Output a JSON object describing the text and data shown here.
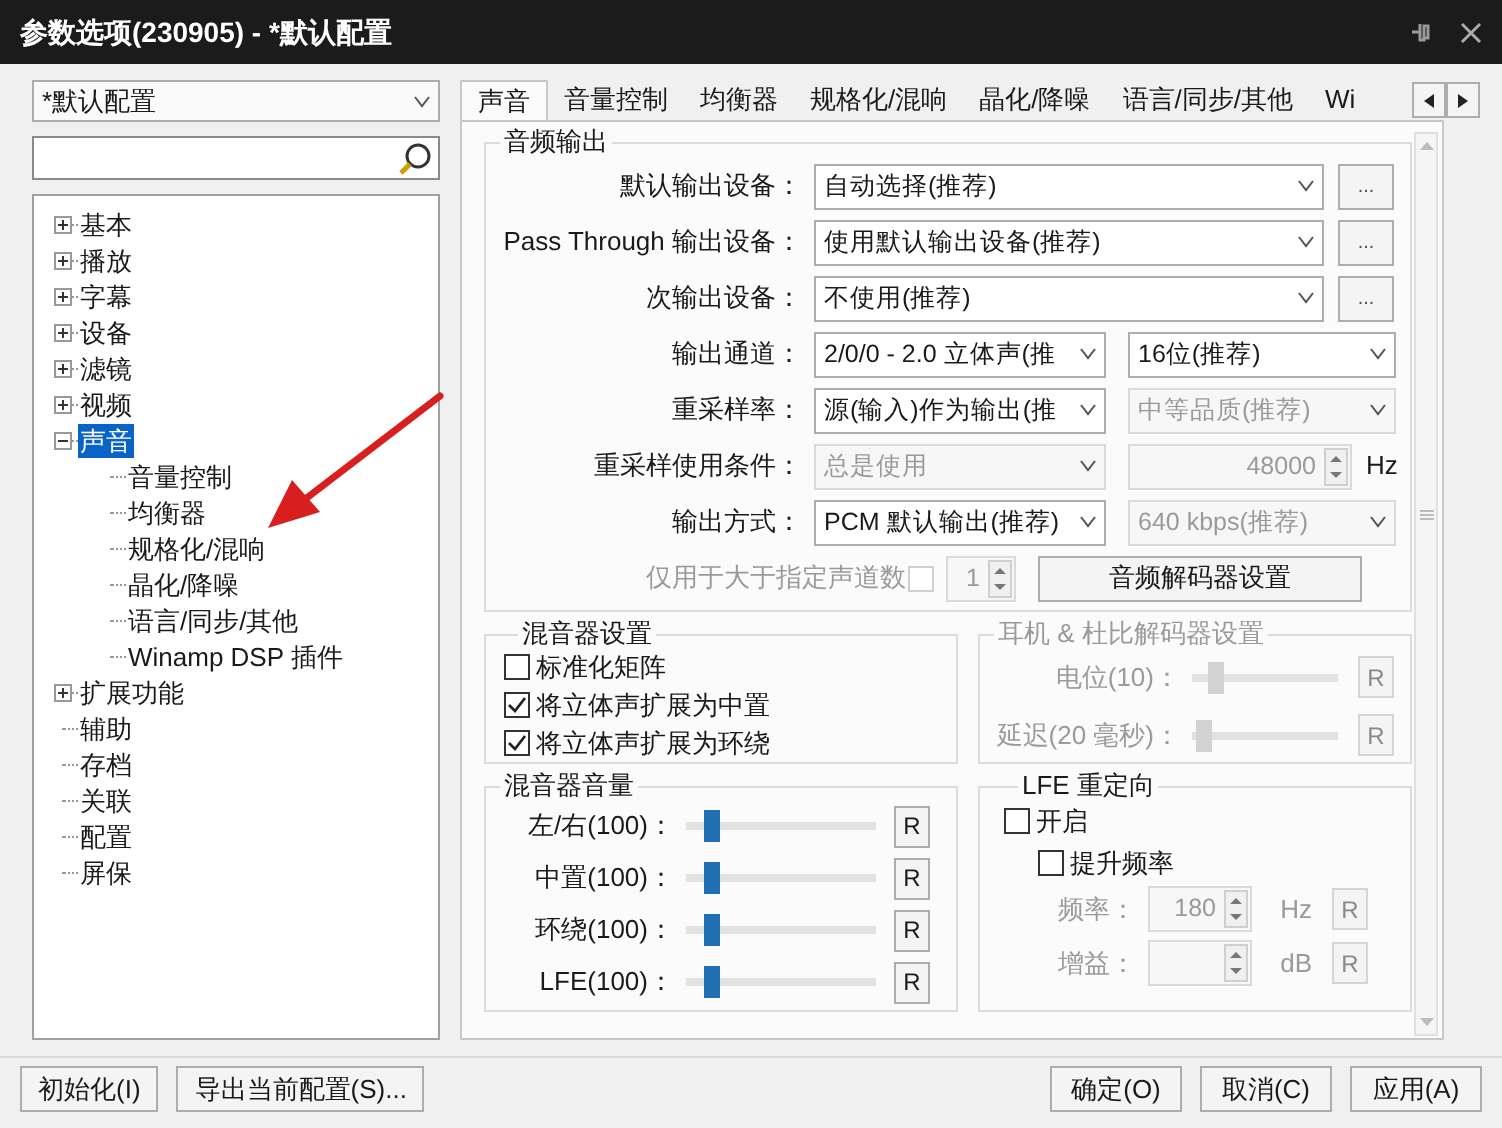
{
  "window": {
    "title": "参数选项(230905) - *默认配置"
  },
  "profile_select": {
    "value": "*默认配置"
  },
  "tree": [
    {
      "label": "基本",
      "kind": "folder",
      "expanded": false,
      "selected": false
    },
    {
      "label": "播放",
      "kind": "folder",
      "expanded": false,
      "selected": false
    },
    {
      "label": "字幕",
      "kind": "folder",
      "expanded": false,
      "selected": false
    },
    {
      "label": "设备",
      "kind": "folder",
      "expanded": false,
      "selected": false
    },
    {
      "label": "滤镜",
      "kind": "folder",
      "expanded": false,
      "selected": false
    },
    {
      "label": "视频",
      "kind": "folder",
      "expanded": false,
      "selected": false
    },
    {
      "label": "声音",
      "kind": "folder",
      "expanded": true,
      "selected": true,
      "children": [
        {
          "label": "音量控制",
          "kind": "leaf",
          "selected": false
        },
        {
          "label": "均衡器",
          "kind": "leaf",
          "selected": false
        },
        {
          "label": "规格化/混响",
          "kind": "leaf",
          "selected": false
        },
        {
          "label": "晶化/降噪",
          "kind": "leaf",
          "selected": false
        },
        {
          "label": "语言/同步/其他",
          "kind": "leaf",
          "selected": false
        },
        {
          "label": "Winamp DSP 插件",
          "kind": "leaf",
          "selected": false
        }
      ]
    },
    {
      "label": "扩展功能",
      "kind": "folder",
      "expanded": false,
      "selected": false
    },
    {
      "label": "辅助",
      "kind": "leaf",
      "selected": false
    },
    {
      "label": "存档",
      "kind": "leaf",
      "selected": false
    },
    {
      "label": "关联",
      "kind": "leaf",
      "selected": false
    },
    {
      "label": "配置",
      "kind": "leaf",
      "selected": false
    },
    {
      "label": "屏保",
      "kind": "leaf",
      "selected": false
    }
  ],
  "tabs": [
    {
      "label": "声音",
      "selected": true
    },
    {
      "label": "音量控制",
      "selected": false
    },
    {
      "label": "均衡器",
      "selected": false
    },
    {
      "label": "规格化/混响",
      "selected": false
    },
    {
      "label": "晶化/降噪",
      "selected": false
    },
    {
      "label": "语言/同步/其他",
      "selected": false
    },
    {
      "label": "Wi",
      "selected": false
    }
  ],
  "audio_output": {
    "title": "音频输出",
    "rows": [
      {
        "kind": "device",
        "label": "默认输出设备：",
        "value": "自动选择(推荐)",
        "button": "..."
      },
      {
        "kind": "device",
        "label": "Pass Through 输出设备：",
        "value": "使用默认输出设备(推荐)",
        "button": "..."
      },
      {
        "kind": "device",
        "label": "次输出设备：",
        "value": "不使用(推荐)",
        "button": "..."
      },
      {
        "kind": "pair",
        "label": "输出通道：",
        "left": {
          "value": "2/0/0 - 2.0 立体声(推",
          "disabled": false
        },
        "right": {
          "value": "16位(推荐)",
          "disabled": false
        }
      },
      {
        "kind": "pair",
        "label": "重采样率：",
        "left": {
          "value": "源(输入)作为输出(推",
          "disabled": false
        },
        "right": {
          "value": "中等品质(推荐)",
          "disabled": true
        }
      },
      {
        "kind": "combo_spin",
        "label": "重采样使用条件：",
        "left": {
          "value": "总是使用",
          "disabled": true
        },
        "spin": {
          "value": "48000",
          "unit": "Hz",
          "disabled": true
        }
      },
      {
        "kind": "pair",
        "label": "输出方式：",
        "left": {
          "value": "PCM 默认输出(推荐)",
          "disabled": false
        },
        "right": {
          "value": "640 kbps(推荐)",
          "disabled": true
        }
      },
      {
        "kind": "channels",
        "label": "仅用于大于指定声道数",
        "checked": false,
        "disabled": true,
        "spin": "1",
        "button": "音频解码器设置"
      }
    ]
  },
  "mixer_settings": {
    "title": "混音器设置",
    "options": [
      {
        "label": "标准化矩阵",
        "checked": false
      },
      {
        "label": "将立体声扩展为中置",
        "checked": true
      },
      {
        "label": "将立体声扩展为环绕",
        "checked": true
      }
    ]
  },
  "headphone": {
    "title": "耳机 & 杜比解码器设置",
    "disabled": true,
    "sliders": [
      {
        "label": "电位(10)：",
        "level": 0.12,
        "reset": "R"
      },
      {
        "label": "延迟(20 毫秒)：",
        "level": 0.03,
        "reset": "R"
      }
    ]
  },
  "mixer_volume": {
    "title": "混音器音量",
    "sliders": [
      {
        "label": "左/右(100)：",
        "level": 0.1,
        "reset": "R"
      },
      {
        "label": "中置(100)：",
        "level": 0.1,
        "reset": "R"
      },
      {
        "label": "环绕(100)：",
        "level": 0.1,
        "reset": "R"
      },
      {
        "label": "LFE(100)：",
        "level": 0.1,
        "reset": "R"
      }
    ]
  },
  "lfe": {
    "title": "LFE 重定向",
    "options": [
      {
        "label": "开启",
        "checked": false,
        "indent": false
      },
      {
        "label": "提升频率",
        "checked": false,
        "indent": true
      }
    ],
    "fields": [
      {
        "label": "频率：",
        "value": "180",
        "unit": "Hz",
        "reset": "R",
        "disabled": true
      },
      {
        "label": "增益：",
        "unit": "dB",
        "reset": "R",
        "disabled": true
      }
    ]
  },
  "footer_left": [
    "初始化(I)",
    "导出当前配置(S)..."
  ],
  "footer_right": [
    "确定(O)",
    "取消(C)",
    "应用(A)"
  ]
}
